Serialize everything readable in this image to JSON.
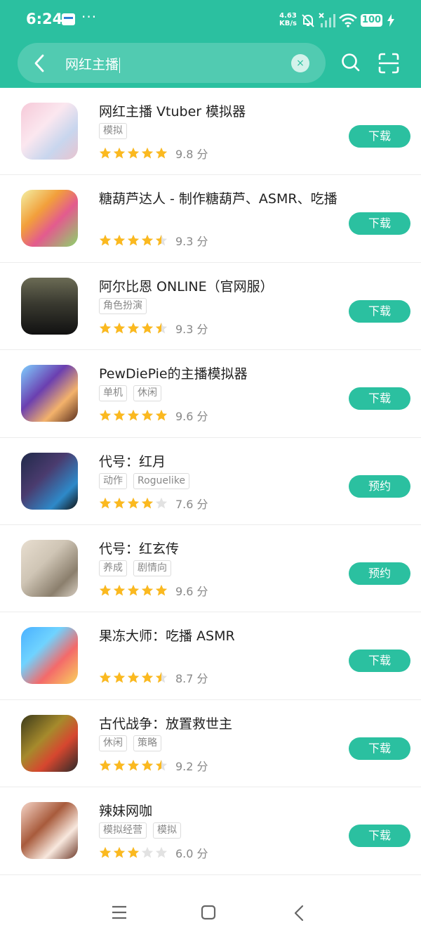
{
  "status_bar": {
    "time": "6:24",
    "app_notification_icon": "card-icon",
    "more": "···",
    "net_speed_value": "4.63",
    "net_speed_unit": "KB/s",
    "battery": "100"
  },
  "search": {
    "value": "网红主播",
    "back_icon": "back-arrow-icon",
    "clear_icon": "clear-icon",
    "clear_glyph": "×",
    "search_icon": "search-icon",
    "scan_icon": "scan-icon"
  },
  "colors": {
    "accent": "#2bc0a0",
    "star": "#fbb91f",
    "star_empty": "#e2e2e2",
    "tag_border": "#dcdcdc",
    "muted_text": "#888888"
  },
  "apps": [
    {
      "name": "网红主播 Vtuber 模拟器",
      "tags": [
        "模拟"
      ],
      "rating": 9.8,
      "stars": 5,
      "score": "9.8 分",
      "action": "下载"
    },
    {
      "name": "糖葫芦达人 - 制作糖葫芦、ASMR、吃播",
      "tags": [],
      "rating": 9.3,
      "stars": 4.5,
      "score": "9.3 分",
      "action": "下载"
    },
    {
      "name": "阿尔比恩 ONLINE（官网服）",
      "tags": [
        "角色扮演"
      ],
      "rating": 9.3,
      "stars": 4.5,
      "score": "9.3 分",
      "action": "下载"
    },
    {
      "name": "PewDiePie的主播模拟器",
      "tags": [
        "单机",
        "休闲"
      ],
      "rating": 9.6,
      "stars": 5,
      "score": "9.6 分",
      "action": "下载"
    },
    {
      "name": "代号：红月",
      "tags": [
        "动作",
        "Roguelike"
      ],
      "rating": 7.6,
      "stars": 4,
      "score": "7.6 分",
      "action": "预约"
    },
    {
      "name": "代号：红玄传",
      "tags": [
        "养成",
        "剧情向"
      ],
      "rating": 9.6,
      "stars": 5,
      "score": "9.6 分",
      "action": "预约"
    },
    {
      "name": "果冻大师：吃播 ASMR",
      "tags": [],
      "rating": 8.7,
      "stars": 4.5,
      "score": "8.7 分",
      "action": "下载"
    },
    {
      "name": "古代战争：放置救世主",
      "tags": [
        "休闲",
        "策略"
      ],
      "rating": 9.2,
      "stars": 4.5,
      "score": "9.2 分",
      "action": "下载"
    },
    {
      "name": "辣妹网咖",
      "tags": [
        "模拟经营",
        "模拟"
      ],
      "rating": 6.0,
      "stars": 3,
      "score": "6.0 分",
      "action": "下载"
    }
  ],
  "nav": {
    "menu_icon": "menu-icon",
    "home_icon": "home-icon",
    "back_icon": "back-icon"
  }
}
